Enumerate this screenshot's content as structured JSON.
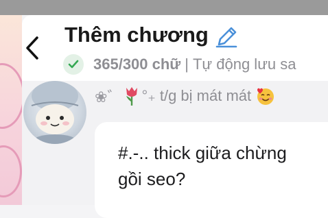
{
  "header": {
    "title": "Thêm chương",
    "word_count": "365/300 chữ",
    "separator": "|",
    "autosave": "Tự động lưu sa"
  },
  "message": {
    "sender": "t/g bị mát mát",
    "sender_prefix": "❀゛",
    "sender_mid": "°₊",
    "text_line1": "#.-.. thick giữa chừng",
    "text_line2": "gồi seo?"
  },
  "colors": {
    "accent_blue": "#4a90d9",
    "check_green": "#34a853",
    "muted_text": "#8e8e93"
  },
  "icons": [
    "chevron-left-icon",
    "pencil-icon",
    "check-icon",
    "tulip-icon",
    "smiling-face-with-hearts-icon"
  ]
}
